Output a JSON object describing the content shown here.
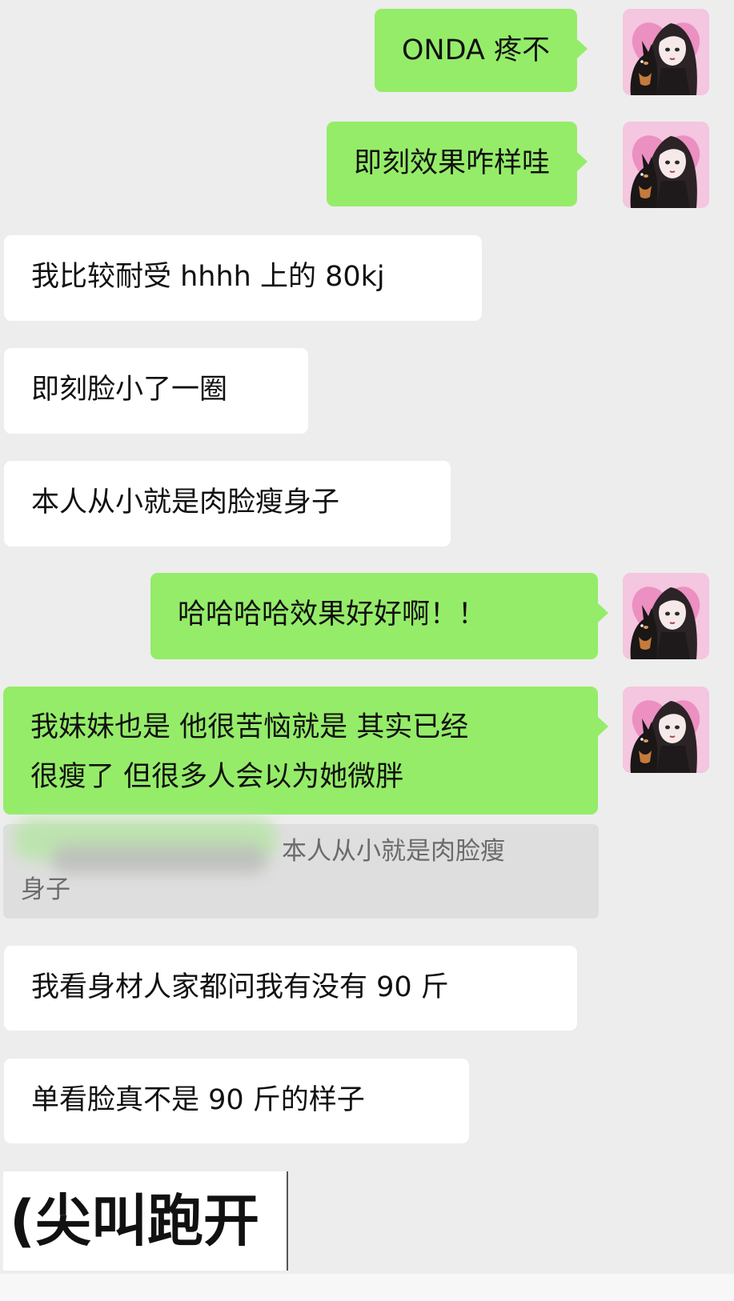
{
  "messages": [
    {
      "text": "ONDA 疼不",
      "side": "right",
      "color": "green"
    },
    {
      "text": "即刻效果咋样哇",
      "side": "right",
      "color": "green"
    },
    {
      "text": "我比较耐受 hhhh 上的 80kj",
      "side": "left",
      "color": "white"
    },
    {
      "text": "即刻脸小了一圈",
      "side": "left",
      "color": "white"
    },
    {
      "text": "本人从小就是肉脸瘦身子",
      "side": "left",
      "color": "white"
    },
    {
      "text": "哈哈哈哈效果好好啊！！",
      "side": "right",
      "color": "green"
    },
    {
      "line1": "我妹妹也是 他很苦恼就是 其实已经",
      "line2": "很瘦了 但很多人会以为她微胖",
      "side": "right",
      "color": "green"
    },
    {
      "text": "我看身材人家都问我有没有 90 斤",
      "side": "left",
      "color": "white"
    },
    {
      "text": "单看脸真不是 90 斤的样子",
      "side": "left",
      "color": "white"
    }
  ],
  "quote": {
    "line1": "本人从小就是肉脸瘦",
    "line2": "身子"
  },
  "caption": "(尖叫跑开",
  "colors": {
    "background": "#ededed",
    "bubble_green": "#95ec69",
    "bubble_white": "#ffffff",
    "quote_bg": "#dedede"
  },
  "icons": {
    "avatar": "avatar-girl-with-doberman-icon"
  }
}
